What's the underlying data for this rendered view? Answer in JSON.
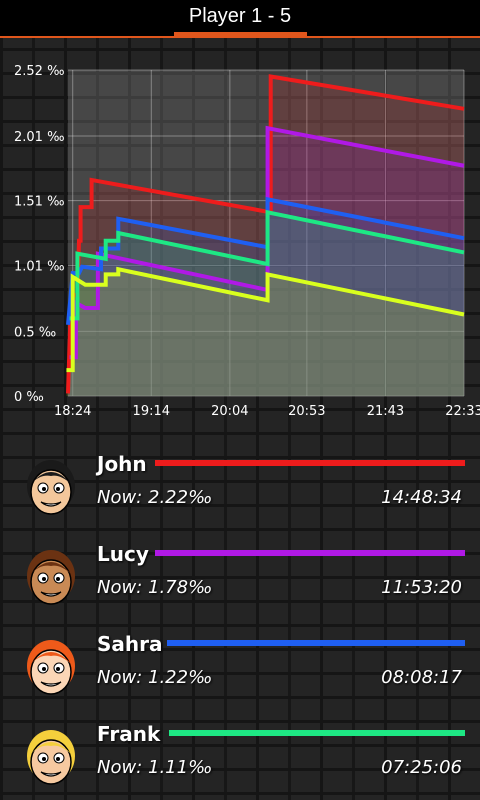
{
  "header": {
    "title": "Player 1 - 5"
  },
  "chart_data": {
    "type": "line",
    "ylim": [
      0,
      2.52
    ],
    "yticks": [
      "0 ‰",
      "0.5 ‰",
      "1.01 ‰",
      "1.51 ‰",
      "2.01 ‰",
      "2.52 ‰"
    ],
    "ytick_values": [
      0,
      0.5,
      1.01,
      1.51,
      2.01,
      2.52
    ],
    "xlim": [
      1101,
      1353
    ],
    "xticks": [
      "18:24",
      "19:14",
      "20:04",
      "20:53",
      "21:43",
      "22:33"
    ],
    "xtick_values": [
      1104,
      1154,
      1204,
      1253,
      1303,
      1353
    ],
    "grid": true,
    "series": [
      {
        "name": "John",
        "color": "#ee1c1c",
        "points": [
          [
            1101,
            0.02
          ],
          [
            1103,
            0.78
          ],
          [
            1107,
            0.78
          ],
          [
            1108,
            1.2
          ],
          [
            1109,
            1.2
          ],
          [
            1109,
            1.46
          ],
          [
            1116,
            1.46
          ],
          [
            1116,
            1.67
          ],
          [
            1230,
            1.42
          ],
          [
            1230,
            2.47
          ],
          [
            1353,
            2.22
          ]
        ]
      },
      {
        "name": "Lucy",
        "color": "#b019e6",
        "points": [
          [
            1102,
            0.3
          ],
          [
            1106,
            0.3
          ],
          [
            1106,
            0.72
          ],
          [
            1112,
            0.68
          ],
          [
            1120,
            0.68
          ],
          [
            1120,
            1.1
          ],
          [
            1228,
            0.82
          ],
          [
            1228,
            2.07
          ],
          [
            1353,
            1.78
          ]
        ]
      },
      {
        "name": "Sahra",
        "color": "#1f5ff2",
        "points": [
          [
            1101,
            0.55
          ],
          [
            1104,
            0.95
          ],
          [
            1108,
            0.95
          ],
          [
            1110,
            1.0
          ],
          [
            1122,
            0.98
          ],
          [
            1122,
            1.14
          ],
          [
            1133,
            1.14
          ],
          [
            1133,
            1.37
          ],
          [
            1228,
            1.15
          ],
          [
            1228,
            1.52
          ],
          [
            1353,
            1.22
          ]
        ]
      },
      {
        "name": "Frank",
        "color": "#1ee884",
        "points": [
          [
            1102,
            0.6
          ],
          [
            1107,
            0.6
          ],
          [
            1107,
            1.1
          ],
          [
            1125,
            1.06
          ],
          [
            1125,
            1.2
          ],
          [
            1133,
            1.2
          ],
          [
            1133,
            1.26
          ],
          [
            1228,
            1.02
          ],
          [
            1228,
            1.42
          ],
          [
            1353,
            1.11
          ]
        ]
      },
      {
        "name": "",
        "color": "#d9ff1e",
        "points": [
          [
            1100,
            0.2
          ],
          [
            1104,
            0.2
          ],
          [
            1104,
            0.92
          ],
          [
            1112,
            0.86
          ],
          [
            1125,
            0.86
          ],
          [
            1125,
            0.94
          ],
          [
            1133,
            0.94
          ],
          [
            1133,
            0.98
          ],
          [
            1228,
            0.74
          ],
          [
            1228,
            0.94
          ],
          [
            1353,
            0.63
          ]
        ]
      }
    ]
  },
  "players": [
    {
      "name": "John",
      "color": "#ee1c1c",
      "now": "Now: 2.22‰",
      "time": "14:48:34",
      "avatar": "john-avatar",
      "hair": "#1a1a1a",
      "skin": "#f3c79b"
    },
    {
      "name": "Lucy",
      "color": "#b019e6",
      "now": "Now: 1.78‰",
      "time": "11:53:20",
      "avatar": "lucy-avatar",
      "hair": "#6b3212",
      "skin": "#c98a55"
    },
    {
      "name": "Sahra",
      "color": "#1f5ff2",
      "now": "Now: 1.22‰",
      "time": "08:08:17",
      "avatar": "sahra-avatar",
      "hair": "#ee5a1a",
      "skin": "#fbd6b6"
    },
    {
      "name": "Frank",
      "color": "#1ee884",
      "now": "Now: 1.11‰",
      "time": "07:25:06",
      "avatar": "frank-avatar",
      "hair": "#f4cf3c",
      "skin": "#f6c9a0"
    }
  ]
}
